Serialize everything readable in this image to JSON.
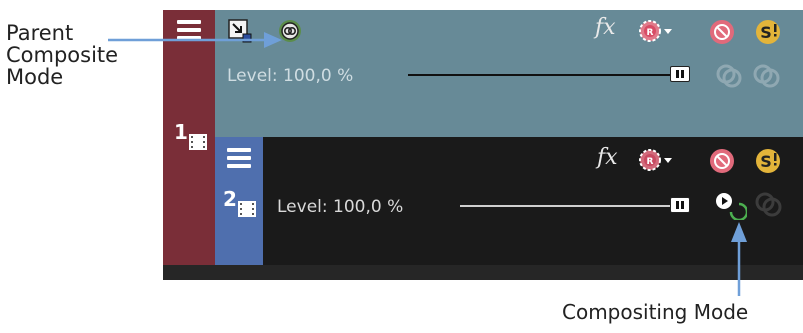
{
  "annotations": {
    "parent_composite_mode": [
      "Parent",
      "Composite",
      "Mode"
    ],
    "compositing_mode": "Compositing Mode"
  },
  "tracks": [
    {
      "number": "1",
      "level_text": "Level: 100,0 %",
      "fx_label": "fx",
      "header_color": "#7a2e38",
      "body_color": "#678a97",
      "slider_level_percent": 100
    },
    {
      "number": "2",
      "level_text": "Level: 100,0 %",
      "fx_label": "fx",
      "header_color": "#4f6fae",
      "body_color": "#1a1a1a",
      "slider_level_percent": 100
    }
  ],
  "icons": {
    "track_menu": "hamburger-icon",
    "expand": "expand-track-icon",
    "parent_composite_mode": "parent-composite-mode-icon",
    "fx": "fx-icon",
    "automation": "automation-settings-icon",
    "mute": "mute-icon",
    "solo": "solo-icon",
    "compositing_mode": "compositing-mode-icon",
    "make_compositing_child": "make-compositing-child-icon"
  },
  "colors": {
    "annotation_arrow": "#6f9fd8",
    "mute_badge": "#e16a7b",
    "solo_badge": "#e3b43a",
    "automation_badge": "#e16a7b"
  }
}
